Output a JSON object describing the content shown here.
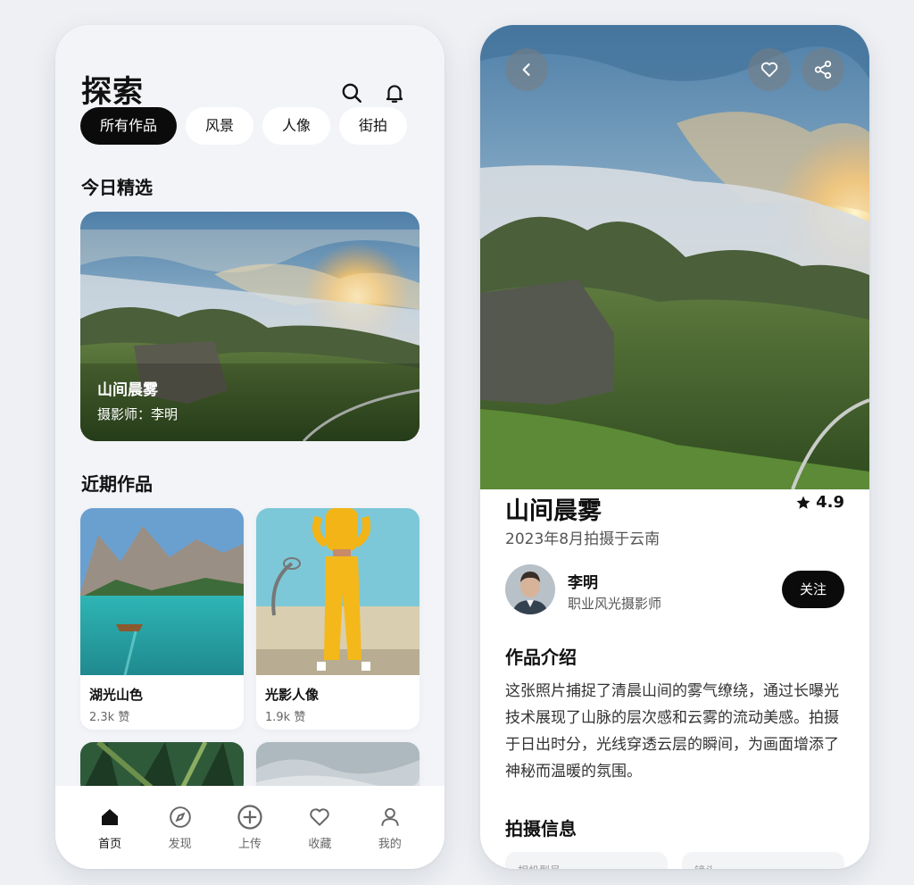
{
  "left": {
    "title": "探索",
    "header_icons": [
      "search-icon",
      "bell-icon"
    ],
    "chips": [
      {
        "label": "所有作品",
        "active": true
      },
      {
        "label": "风景",
        "active": false
      },
      {
        "label": "人像",
        "active": false
      },
      {
        "label": "街拍",
        "active": false
      }
    ],
    "featured_section_title": "今日精选",
    "featured": {
      "title": "山间晨雾",
      "subtitle": "摄影师：李明"
    },
    "recent_section_title": "近期作品",
    "recent": [
      {
        "title": "湖光山色",
        "likes": "2.3k 赞"
      },
      {
        "title": "光影人像",
        "likes": "1.9k 赞"
      }
    ],
    "tabs": [
      {
        "label": "首页",
        "icon": "home-icon",
        "active": true
      },
      {
        "label": "发现",
        "icon": "compass-icon",
        "active": false
      },
      {
        "label": "上传",
        "icon": "plus-circle-icon",
        "active": false
      },
      {
        "label": "收藏",
        "icon": "heart-icon",
        "active": false
      },
      {
        "label": "我的",
        "icon": "user-icon",
        "active": false
      }
    ]
  },
  "right": {
    "buttons": [
      "back-icon",
      "heart-icon",
      "share-icon"
    ],
    "title": "山间晨雾",
    "rating": "4.9",
    "subtitle": "2023年8月拍摄于云南",
    "author": {
      "name": "李明",
      "role": "职业风光摄影师",
      "follow_label": "关注"
    },
    "intro_title": "作品介绍",
    "intro_text": "这张照片捕捉了清晨山间的雾气缭绕，通过长曝光技术展现了山脉的层次感和云雾的流动美感。拍摄于日出时分，光线穿透云层的瞬间，为画面增添了神秘而温暖的氛围。",
    "shoot_title": "拍摄信息",
    "info_cards": [
      "相机型号",
      "镜头"
    ]
  },
  "colors": {
    "accent": "#0b0b0b",
    "background": "#eef0f4",
    "card": "#ffffff"
  }
}
